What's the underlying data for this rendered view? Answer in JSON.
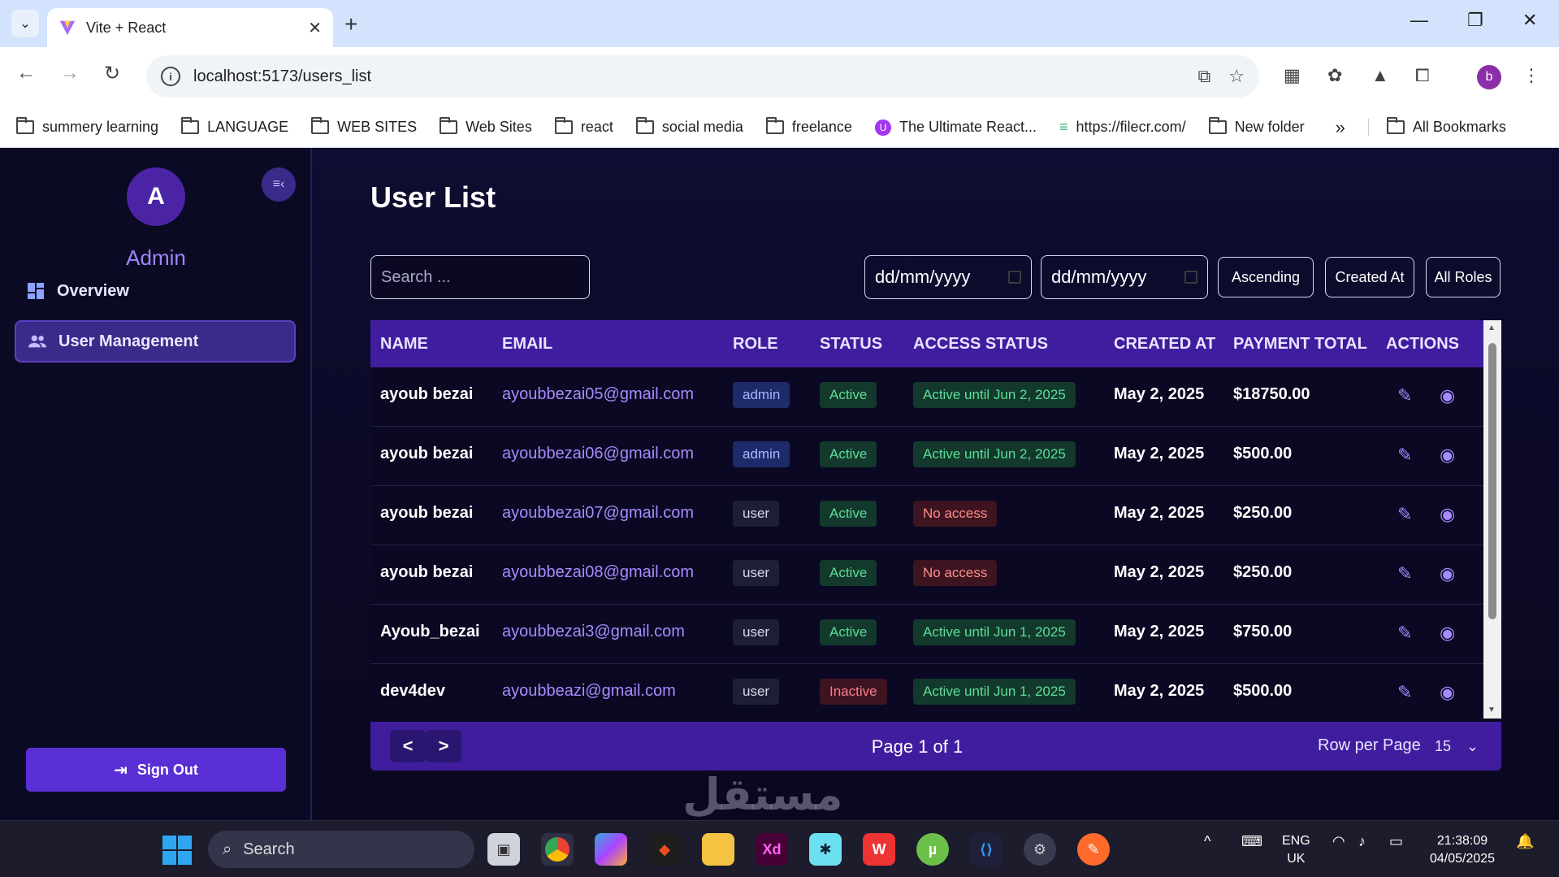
{
  "browser": {
    "tab_title": "Vite + React",
    "url": "localhost:5173/users_list",
    "profile_initial": "b",
    "bookmarks": [
      "summery learning",
      "LANGUAGE",
      "WEB SITES",
      "Web Sites",
      "react",
      "social media",
      "freelance",
      "The Ultimate React...",
      "https://filecr.com/",
      "New folder"
    ],
    "all_bookmarks": "All Bookmarks",
    "more": "»"
  },
  "sidebar": {
    "avatar_initial": "A",
    "user_name": "Admin",
    "nav": [
      {
        "label": "Overview",
        "icon": "grid-icon"
      },
      {
        "label": "User Management",
        "icon": "users-icon"
      }
    ],
    "signout_label": "Sign Out"
  },
  "main": {
    "title": "User List",
    "search_placeholder": "Search ...",
    "date_from": "dd/mm/yyyy",
    "date_to": "dd/mm/yyyy",
    "sort_order": "Ascending",
    "sort_by": "Created At",
    "role_filter": "All Roles"
  },
  "table": {
    "columns": [
      "NAME",
      "EMAIL",
      "ROLE",
      "STATUS",
      "ACCESS STATUS",
      "CREATED AT",
      "PAYMENT TOTAL",
      "ACTIONS"
    ],
    "rows": [
      {
        "name": "ayoub bezai",
        "email": "ayoubbezai05@gmail.com",
        "role": "admin",
        "status": "Active",
        "access": "Active until Jun 2, 2025",
        "created": "May 2, 2025",
        "payment": "$18750.00"
      },
      {
        "name": "ayoub bezai",
        "email": "ayoubbezai06@gmail.com",
        "role": "admin",
        "status": "Active",
        "access": "Active until Jun 2, 2025",
        "created": "May 2, 2025",
        "payment": "$500.00"
      },
      {
        "name": "ayoub bezai",
        "email": "ayoubbezai07@gmail.com",
        "role": "user",
        "status": "Active",
        "access": "No access",
        "created": "May 2, 2025",
        "payment": "$250.00"
      },
      {
        "name": "ayoub bezai",
        "email": "ayoubbezai08@gmail.com",
        "role": "user",
        "status": "Active",
        "access": "No access",
        "created": "May 2, 2025",
        "payment": "$250.00"
      },
      {
        "name": "Ayoub_bezai",
        "email": "ayoubbezai3@gmail.com",
        "role": "user",
        "status": "Active",
        "access": "Active until Jun 1, 2025",
        "created": "May 2, 2025",
        "payment": "$750.00"
      },
      {
        "name": "dev4dev",
        "email": "ayoubbeazi@gmail.com",
        "role": "user",
        "status": "Inactive",
        "access": "Active until Jun 1, 2025",
        "created": "May 2, 2025",
        "payment": "$500.00"
      }
    ]
  },
  "pager": {
    "prev": "<",
    "next": ">",
    "info": "Page 1 of 1",
    "rows_label": "Row per Page",
    "rows_value": "15"
  },
  "watermark": "مستقل",
  "taskbar": {
    "search": "Search",
    "lang_1": "ENG",
    "lang_2": "UK",
    "time": "21:38:09",
    "date": "04/05/2025"
  },
  "colors": {
    "accent": "#3f1d9e",
    "sidebar_active": "#3a2a8a",
    "signout": "#5a2fd6",
    "email": "#a98bff"
  }
}
